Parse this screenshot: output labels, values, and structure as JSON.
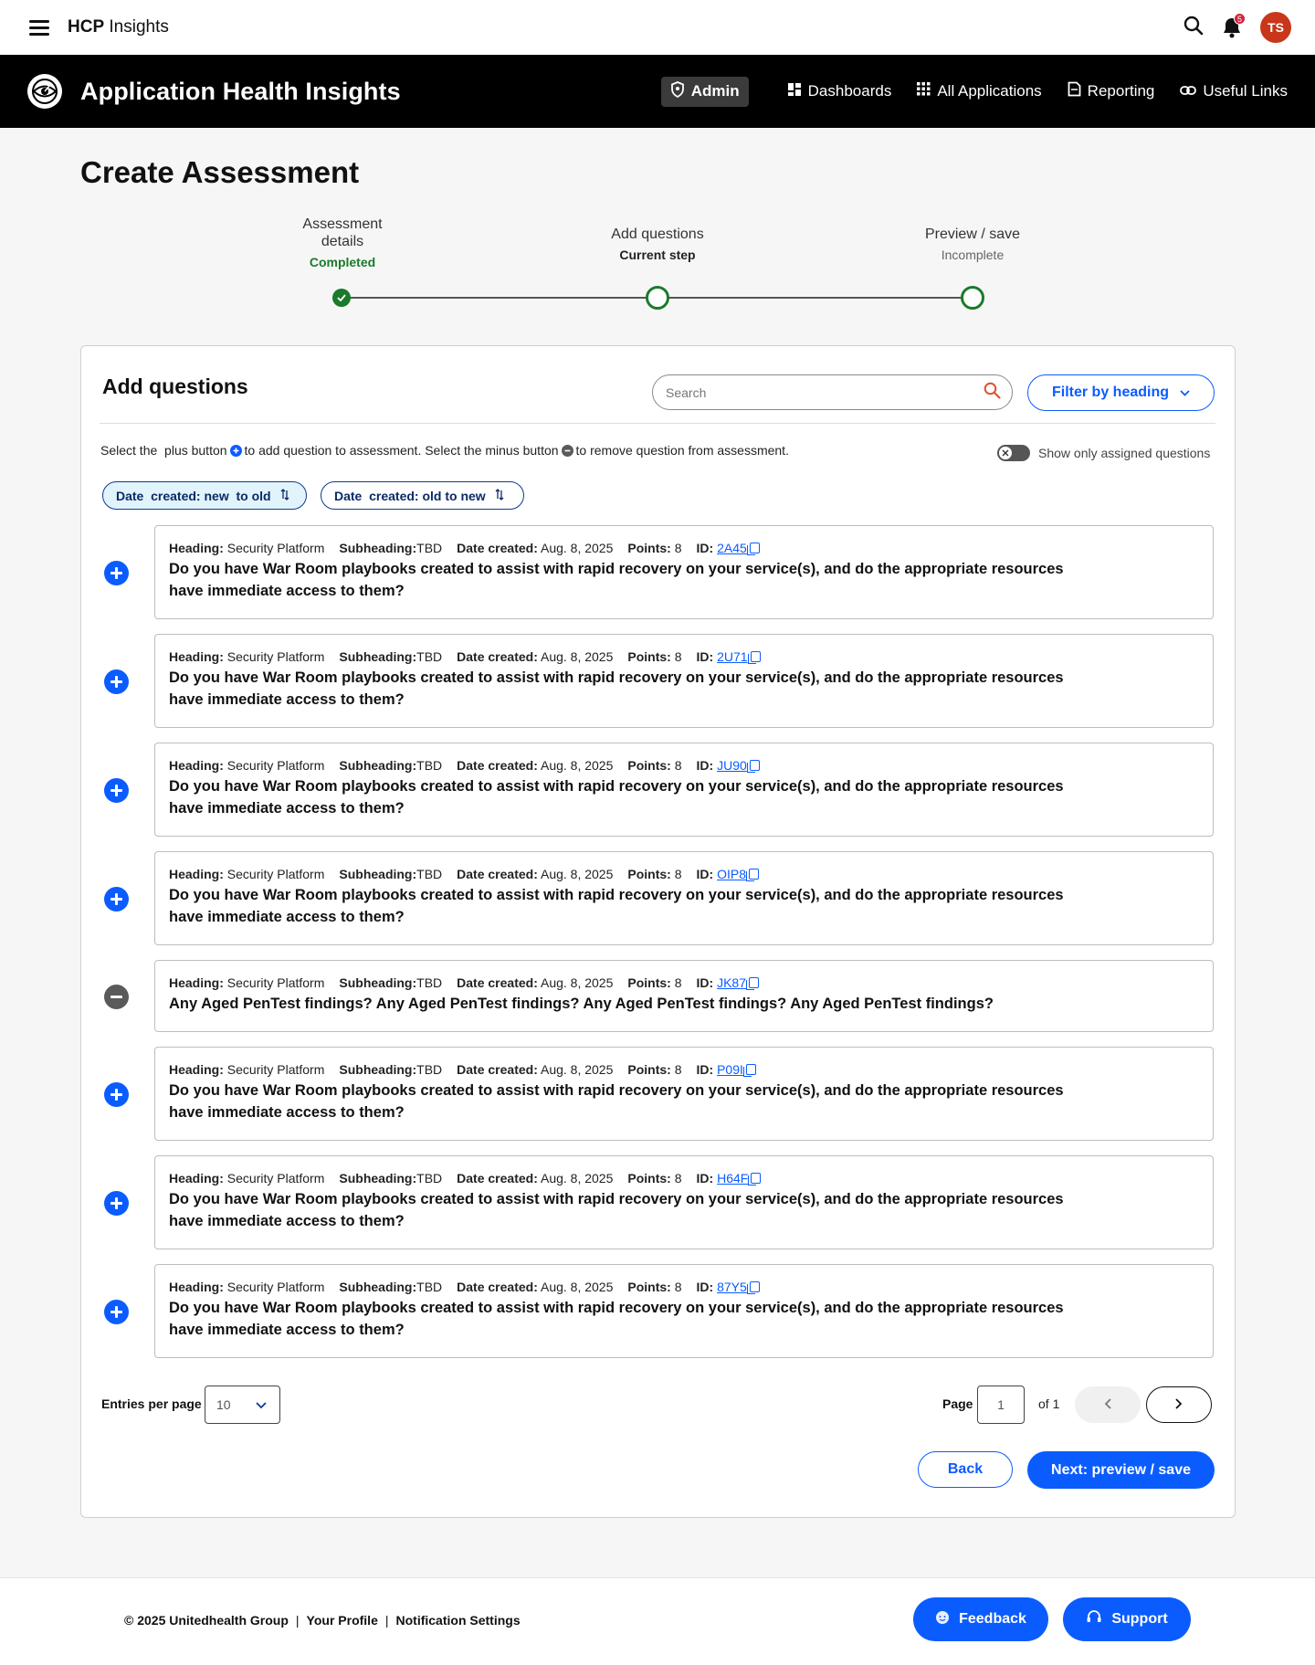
{
  "topbar": {
    "brand_bold": "HCP",
    "brand_rest": " Insights",
    "notification_count": "5",
    "avatar_initials": "TS"
  },
  "nav": {
    "app_title": "Application Health Insights",
    "admin": "Admin",
    "links": [
      "Dashboards",
      "All Applications",
      "Reporting",
      "Useful Links"
    ]
  },
  "page": {
    "title": "Create Assessment"
  },
  "stepper": [
    {
      "label": "Assessment details",
      "status": "Completed"
    },
    {
      "label": "Add questions",
      "status": "Current step"
    },
    {
      "label": "Preview / save",
      "status": "Incomplete"
    }
  ],
  "card": {
    "title": "Add questions",
    "search_placeholder": "Search",
    "filter_label": "Filter by heading",
    "instruction_a": "Select the  plus button",
    "instruction_b": "to add question to assessment. Select the minus button",
    "instruction_c": "to remove question from assessment.",
    "toggle_label": "Show only assigned questions",
    "sort_new_old": "Date  created: new  to old",
    "sort_old_new": "Date  created: old to new"
  },
  "labels": {
    "heading": "Heading:",
    "subheading": "Subheading:",
    "date_created": "Date created:",
    "points": "Points:",
    "id": "ID:"
  },
  "questions": [
    {
      "heading": "Security Platform",
      "subheading": "TBD",
      "date": "Aug. 8, 2025",
      "points": "8",
      "id": "2A45",
      "text": "Do you have War Room playbooks created to assist with rapid recovery on your service(s), and do the appropriate resources have immediate access to them?",
      "assigned": false
    },
    {
      "heading": "Security Platform",
      "subheading": "TBD",
      "date": "Aug. 8, 2025",
      "points": "8",
      "id": "2U71",
      "text": "Do you have War Room playbooks created to assist with rapid recovery on your service(s), and do the appropriate resources have immediate access to them?",
      "assigned": false
    },
    {
      "heading": "Security Platform",
      "subheading": "TBD",
      "date": "Aug. 8, 2025",
      "points": "8",
      "id": "JU90",
      "text": "Do you have War Room playbooks created to assist with rapid recovery on your service(s), and do the appropriate resources have immediate access to them?",
      "assigned": false
    },
    {
      "heading": "Security Platform",
      "subheading": "TBD",
      "date": "Aug. 8, 2025",
      "points": "8",
      "id": "OIP8",
      "text": "Do you have War Room playbooks created to assist with rapid recovery on your service(s), and do the appropriate resources have immediate access to them?",
      "assigned": false
    },
    {
      "heading": "Security Platform",
      "subheading": "TBD",
      "date": "Aug. 8, 2025",
      "points": "8",
      "id": "JK87",
      "text": "Any Aged PenTest findings? Any Aged PenTest findings? Any Aged PenTest findings? Any Aged PenTest findings?",
      "assigned": true
    },
    {
      "heading": "Security Platform",
      "subheading": "TBD",
      "date": "Aug. 8, 2025",
      "points": "8",
      "id": "P09I",
      "text": "Do you have War Room playbooks created to assist with rapid recovery on your service(s), and do the appropriate resources have immediate access to them?",
      "assigned": false
    },
    {
      "heading": "Security Platform",
      "subheading": "TBD",
      "date": "Aug. 8, 2025",
      "points": "8",
      "id": "H64F",
      "text": "Do you have War Room playbooks created to assist with rapid recovery on your service(s), and do the appropriate resources have immediate access to them?",
      "assigned": false
    },
    {
      "heading": "Security Platform",
      "subheading": "TBD",
      "date": "Aug. 8, 2025",
      "points": "8",
      "id": "87Y5",
      "text": "Do you have War Room playbooks created to assist with rapid recovery on your service(s), and do the appropriate resources have immediate access to them?",
      "assigned": false
    }
  ],
  "pagination": {
    "entries_label": "Entries per page",
    "entries_value": "10",
    "page_label": "Page",
    "page_value": "1",
    "of_label": "of 1"
  },
  "actions": {
    "back": "Back",
    "next": "Next: preview / save"
  },
  "footer": {
    "copyright": "© 2025 Unitedhealth Group",
    "profile": "Your Profile",
    "notifications": "Notification Settings",
    "feedback": "Feedback",
    "support": "Support"
  },
  "colors": {
    "primary": "#0b5cff",
    "success": "#1b7a2b",
    "nav_bg": "#000000",
    "avatar": "#c9371a",
    "badge": "#d1233c"
  }
}
